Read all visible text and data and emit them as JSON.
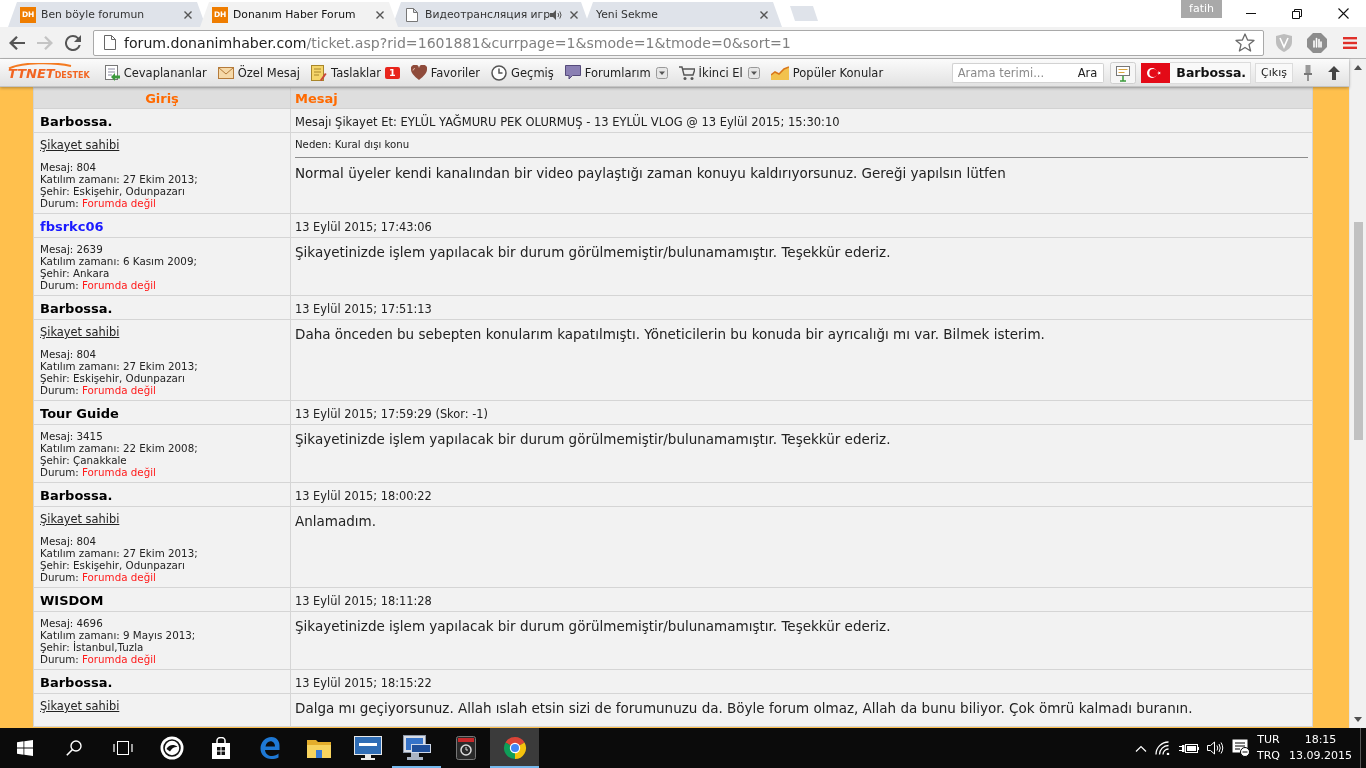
{
  "browser": {
    "tabs": [
      {
        "title": "Ben böyle forumun",
        "selected": false,
        "audio": false,
        "favicon": {
          "kind": "letters",
          "text": "DH"
        }
      },
      {
        "title": "Donanım Haber Forum",
        "selected": true,
        "audio": false,
        "favicon": {
          "kind": "letters",
          "text": "DH"
        }
      },
      {
        "title": "Видеотрансляция игр",
        "selected": false,
        "audio": true,
        "favicon": {
          "kind": "page"
        }
      },
      {
        "title": "Yeni Sekme",
        "selected": false,
        "audio": false
      }
    ],
    "profile": "fatih",
    "nav": {
      "back_enabled": true,
      "forward_enabled": false
    },
    "address": {
      "host": "forum.donanimhaber.com",
      "path": "/ticket.asp?rid=1601881&currpage=1&smode=1&tmode=0&sort=1"
    }
  },
  "site_bar": {
    "logo": {
      "brand": "TTNET",
      "tag": "DESTEK"
    },
    "links": [
      {
        "label": "Cevaplananlar",
        "kind": "replies",
        "dropdown": false
      },
      {
        "label": "Özel Mesaj",
        "kind": "mail",
        "dropdown": false
      },
      {
        "label": "Taslaklar",
        "kind": "drafts",
        "badge": "1",
        "dropdown": false
      },
      {
        "label": "Favoriler",
        "kind": "heart",
        "dropdown": false
      },
      {
        "label": "Geçmiş",
        "kind": "history",
        "dropdown": false
      },
      {
        "label": "Forumlarım",
        "kind": "forums",
        "dropdown": true
      },
      {
        "label": "İkinci El",
        "kind": "cart",
        "dropdown": true
      },
      {
        "label": "Popüler Konular",
        "kind": "chart",
        "dropdown": false
      }
    ],
    "search": {
      "placeholder": "Arama terimi...",
      "button": "Ara"
    },
    "user": "Barbossa.",
    "logout": "Çıkış"
  },
  "table": {
    "columns": [
      "Giriş",
      "Mesaj"
    ],
    "posts": [
      {
        "kind": "complaint",
        "author": "Barbossa.",
        "color": "#000000",
        "header": "Mesajı Şikayet Et: EYLÜL YAĞMURU PEK OLURMUŞ - 13 EYLÜL VLOG @ 13 Eylül 2015; 15:30:10",
        "complainant_link": "Şikayet sahibi",
        "stats": [
          "Mesaj: 804",
          "Katılım zamanı: 27 Ekim 2013;",
          "Şehir: Eskişehir, Odunpazarı"
        ],
        "status": {
          "label": "Durum:",
          "value": "Forumda değil"
        },
        "reason": "Neden: Kural dışı konu",
        "message": "Normal üyeler kendi kanalından bir video paylaştığı zaman konuyu kaldırıyorsunuz. Gereği yapılsın lütfen"
      },
      {
        "kind": "reply",
        "author": "fbsrkc06",
        "color": "#1a1aff",
        "header": "13 Eylül 2015; 17:43:06",
        "stats": [
          "Mesaj: 2639",
          "Katılım zamanı: 6 Kasım 2009;",
          "Şehir: Ankara"
        ],
        "status": {
          "label": "Durum:",
          "value": "Forumda değil"
        },
        "message": "Şikayetinizde işlem yapılacak bir durum görülmemiştir/bulunamamıştır. Teşekkür ederiz."
      },
      {
        "kind": "reply",
        "author": "Barbossa.",
        "color": "#000000",
        "header": "13 Eylül 2015; 17:51:13",
        "complainant_link": "Şikayet sahibi",
        "stats": [
          "Mesaj: 804",
          "Katılım zamanı: 27 Ekim 2013;",
          "Şehir: Eskişehir, Odunpazarı"
        ],
        "status": {
          "label": "Durum:",
          "value": "Forumda değil"
        },
        "message": "Daha önceden bu sebepten konularım kapatılmıştı. Yöneticilerin bu konuda bir ayrıcalığı mı var. Bilmek isterim."
      },
      {
        "kind": "reply",
        "author": "Tour Guide",
        "color": "#000000",
        "header": "13 Eylül 2015; 17:59:29 (Skor: -1)",
        "stats": [
          "Mesaj: 3415",
          "Katılım zamanı: 22 Ekim 2008;",
          "Şehir: Çanakkale"
        ],
        "status": {
          "label": "Durum:",
          "value": "Forumda değil"
        },
        "message": "Şikayetinizde işlem yapılacak bir durum görülmemiştir/bulunamamıştır. Teşekkür ederiz."
      },
      {
        "kind": "reply",
        "author": "Barbossa.",
        "color": "#000000",
        "header": "13 Eylül 2015; 18:00:22",
        "complainant_link": "Şikayet sahibi",
        "stats": [
          "Mesaj: 804",
          "Katılım zamanı: 27 Ekim 2013;",
          "Şehir: Eskişehir, Odunpazarı"
        ],
        "status": {
          "label": "Durum:",
          "value": "Forumda değil"
        },
        "message": "Anlamadım."
      },
      {
        "kind": "reply",
        "author": "WISDOM",
        "color": "#000000",
        "header": "13 Eylül 2015; 18:11:28",
        "stats": [
          "Mesaj: 4696",
          "Katılım zamanı: 9 Mayıs 2013;",
          "Şehir: İstanbul,Tuzla"
        ],
        "status": {
          "label": "Durum:",
          "value": "Forumda değil"
        },
        "message": "Şikayetinizde işlem yapılacak bir durum görülmemiştir/bulunamamıştır. Teşekkür ederiz."
      },
      {
        "kind": "reply",
        "author": "Barbossa.",
        "color": "#000000",
        "header": "13 Eylül 2015; 18:15:22",
        "complainant_link": "Şikayet sahibi",
        "message": "Dalga mı geçiyorsunuz. Allah ıslah etsin sizi de forumunuzu da. Böyle forum olmaz, Allah da bunu biliyor. Çok ömrü kalmadı buranın."
      }
    ]
  },
  "taskbar": {
    "apps": [
      {
        "kind": "ring",
        "running": false,
        "selected": false
      },
      {
        "kind": "store",
        "running": false,
        "selected": false
      },
      {
        "kind": "edge",
        "running": false,
        "selected": false
      },
      {
        "kind": "folder",
        "running": false,
        "selected": false
      },
      {
        "kind": "monitor",
        "running": false,
        "selected": false
      },
      {
        "kind": "computer",
        "running": true,
        "selected": false
      },
      {
        "kind": "camera",
        "running": false,
        "selected": false
      },
      {
        "kind": "wheel",
        "running": true,
        "selected": true
      }
    ],
    "language": {
      "code": "TUR",
      "layout": "TRQ"
    },
    "clock": {
      "time": "18:15",
      "date": "13.09.2015"
    }
  }
}
